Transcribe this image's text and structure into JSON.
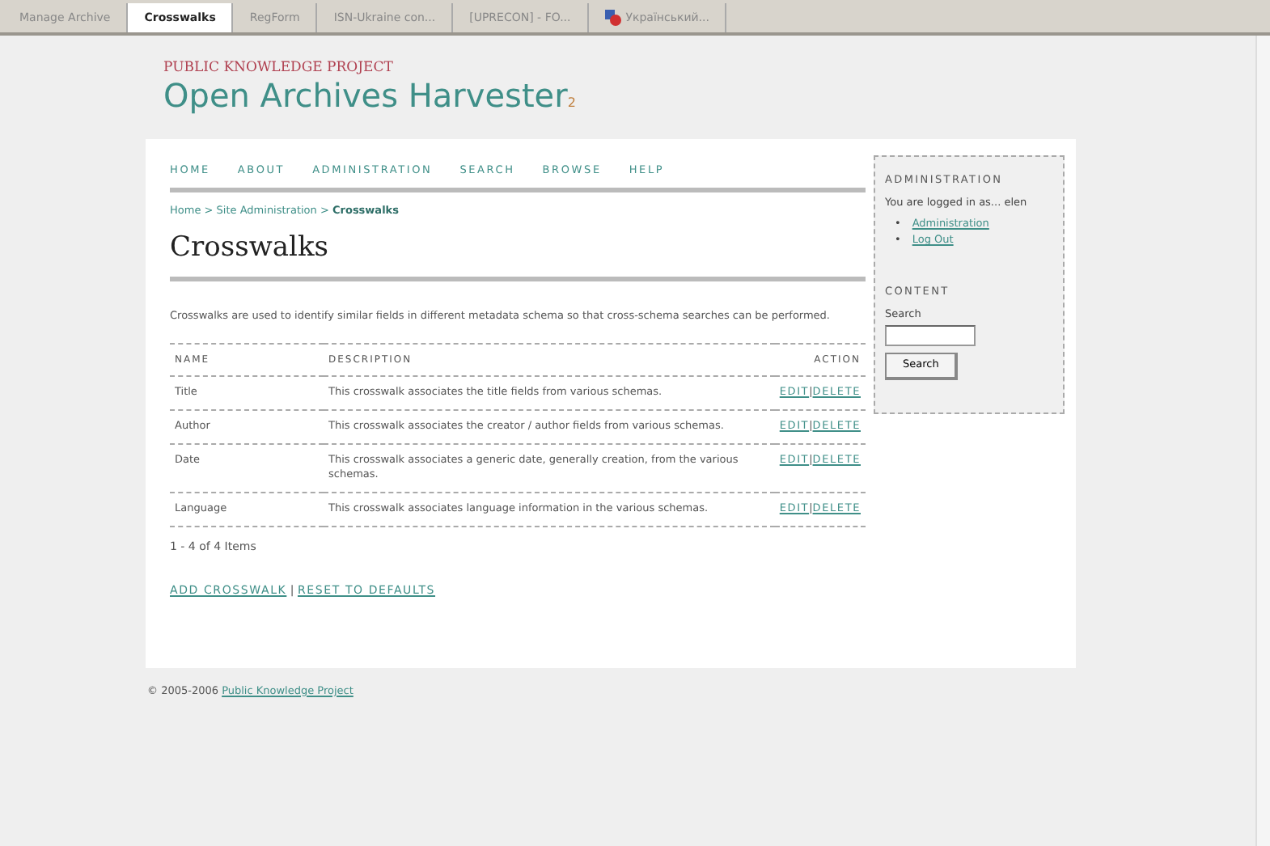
{
  "browser_tabs": [
    {
      "label": "Manage Archive",
      "selected": false,
      "icon": false
    },
    {
      "label": "Crosswalks",
      "selected": true,
      "icon": false
    },
    {
      "label": "RegForm",
      "selected": false,
      "icon": false
    },
    {
      "label": "ISN-Ukraine con...",
      "selected": false,
      "icon": false
    },
    {
      "label": "[UPRECON] - FO...",
      "selected": false,
      "icon": false
    },
    {
      "label": "Український...",
      "selected": false,
      "icon": true
    }
  ],
  "header": {
    "org": "PUBLIC KNOWLEDGE PROJECT",
    "title": "Open Archives Harvester",
    "version": "2"
  },
  "nav": [
    "HOME",
    "ABOUT",
    "ADMINISTRATION",
    "SEARCH",
    "BROWSE",
    "HELP"
  ],
  "breadcrumb": [
    {
      "label": "Home",
      "current": false
    },
    {
      "label": "Site Administration",
      "current": false
    },
    {
      "label": "Crosswalks",
      "current": true
    }
  ],
  "separator": ">",
  "page_title": "Crosswalks",
  "intro": "Crosswalks are used to identify similar fields in different metadata schema so that cross-schema searches can be performed.",
  "table": {
    "columns": [
      "NAME",
      "DESCRIPTION",
      "ACTION"
    ],
    "rows": [
      {
        "name": "Title",
        "description": "This crosswalk associates the title fields from various schemas.",
        "actions": [
          "EDIT",
          "DELETE"
        ]
      },
      {
        "name": "Author",
        "description": "This crosswalk associates the creator / author fields from various schemas.",
        "actions": [
          "EDIT",
          "DELETE"
        ]
      },
      {
        "name": "Date",
        "description": "This crosswalk associates a generic date, generally creation, from the various schemas.",
        "actions": [
          "EDIT",
          "DELETE"
        ]
      },
      {
        "name": "Language",
        "description": "This crosswalk associates language information in the various schemas.",
        "actions": [
          "EDIT",
          "DELETE"
        ]
      }
    ],
    "count": "1 - 4 of 4 Items"
  },
  "bottom_links": [
    "ADD CROSSWALK",
    "RESET TO DEFAULTS"
  ],
  "link_separator": "|",
  "sidebar": {
    "admin_heading": "ADMINISTRATION",
    "logged_in": "You are logged in as... elen",
    "links": [
      "Administration",
      "Log Out"
    ],
    "bullet": "•",
    "content_heading": "CONTENT",
    "search_label": "Search",
    "search_button": "Search"
  },
  "footer": {
    "text": "© 2005-2006",
    "link": "Public Knowledge Project"
  }
}
